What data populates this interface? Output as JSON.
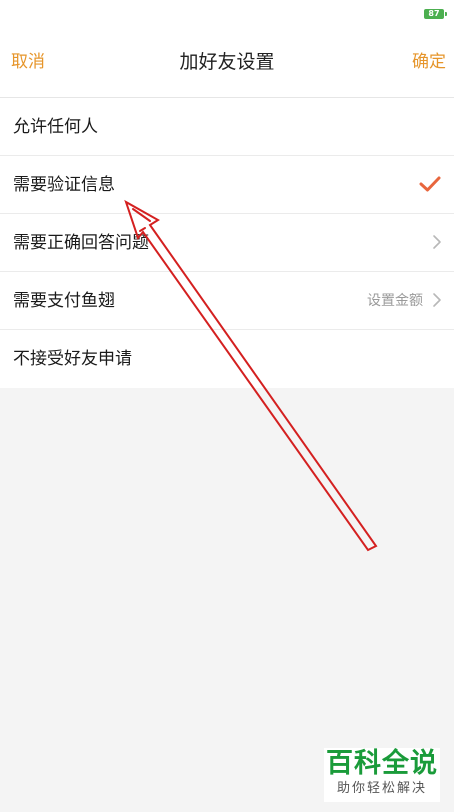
{
  "status_bar": {
    "battery_level": "87"
  },
  "nav": {
    "cancel_label": "取消",
    "title": "加好友设置",
    "confirm_label": "确定"
  },
  "options": [
    {
      "label": "允许任何人",
      "selected": false,
      "accessory": "none"
    },
    {
      "label": "需要验证信息",
      "selected": true,
      "accessory": "check-icon"
    },
    {
      "label": "需要正确回答问题",
      "selected": false,
      "accessory": "chevron-icon"
    },
    {
      "label": "需要支付鱼翅",
      "selected": false,
      "accessory": "chevron-icon",
      "hint": "设置金额"
    },
    {
      "label": "不接受好友申请",
      "selected": false,
      "accessory": "none"
    }
  ],
  "watermark": {
    "main": "百科全说",
    "sub": "助你轻松解决"
  },
  "colors": {
    "accent": "#e6952a",
    "check": "#e8663d",
    "annotation": "#d42020",
    "watermark": "#1a9b3a",
    "battery": "#4caf50"
  }
}
